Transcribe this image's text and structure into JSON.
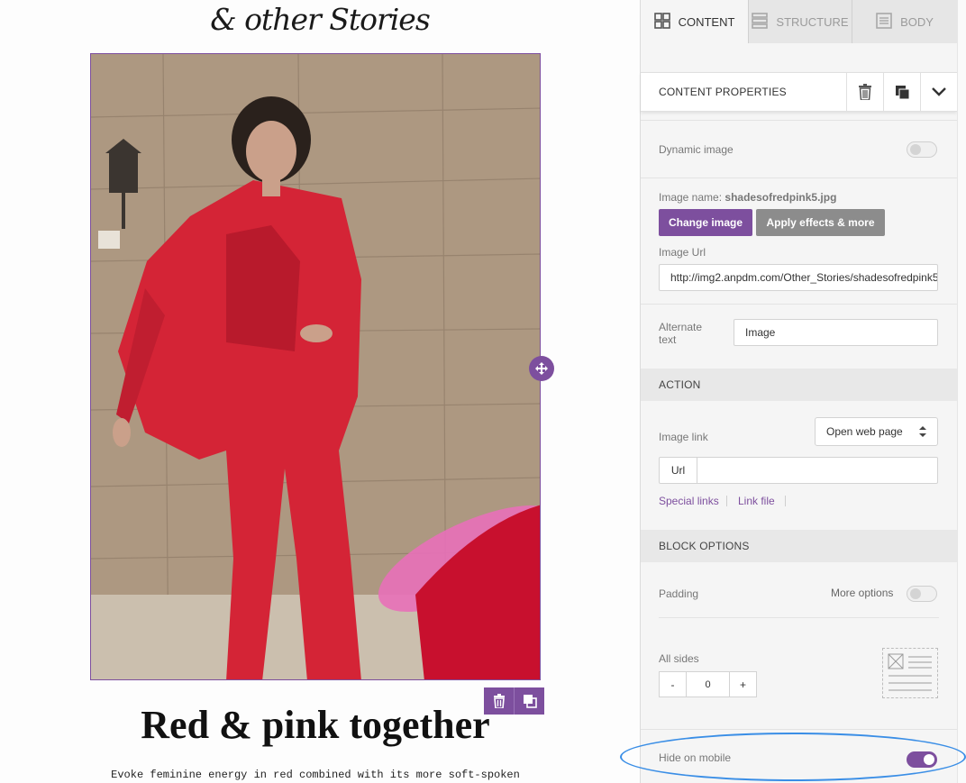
{
  "brand": {
    "logo_text": "& other Stories"
  },
  "email": {
    "image_alt": "Image",
    "headline": "Red & pink together",
    "body_text": "Evoke feminine energy in red combined with its more soft-spoken"
  },
  "tabs": [
    {
      "label": "CONTENT",
      "icon": "grid-icon",
      "active": true
    },
    {
      "label": "STRUCTURE",
      "icon": "rows-icon",
      "active": false
    },
    {
      "label": "BODY",
      "icon": "document-icon",
      "active": false
    }
  ],
  "content_properties": {
    "title": "CONTENT PROPERTIES",
    "actions": [
      "trash-icon",
      "duplicate-icon",
      "chevron-down-icon"
    ]
  },
  "image_settings": {
    "dynamic_image_label": "Dynamic image",
    "dynamic_image_on": false,
    "image_name_label": "Image name:",
    "image_name": "shadesofredpink5.jpg",
    "change_image_label": "Change image",
    "apply_effects_label": "Apply effects & more",
    "image_url_label": "Image Url",
    "image_url": "http://img2.anpdm.com/Other_Stories/shadesofredpink5.jpg",
    "alt_text_label_line1": "Alternate",
    "alt_text_label_line2": "text",
    "alt_text_value": "Image"
  },
  "action": {
    "section_title": "ACTION",
    "image_link_label": "Image link",
    "image_link_option": "Open web page",
    "url_addon": "Url",
    "url_value": "",
    "special_links_label": "Special links",
    "link_file_label": "Link file"
  },
  "block_options": {
    "section_title": "BLOCK OPTIONS",
    "padding_label": "Padding",
    "more_options_label": "More options",
    "more_options_on": false,
    "all_sides_label": "All sides",
    "minus_label": "-",
    "padding_value": "0",
    "plus_label": "+",
    "hide_on_mobile_label": "Hide on mobile",
    "hide_on_mobile_on": true
  },
  "colors": {
    "accent": "#7d4f9e",
    "highlight": "#3a8ee6",
    "muted_button": "#8c8c8c"
  }
}
